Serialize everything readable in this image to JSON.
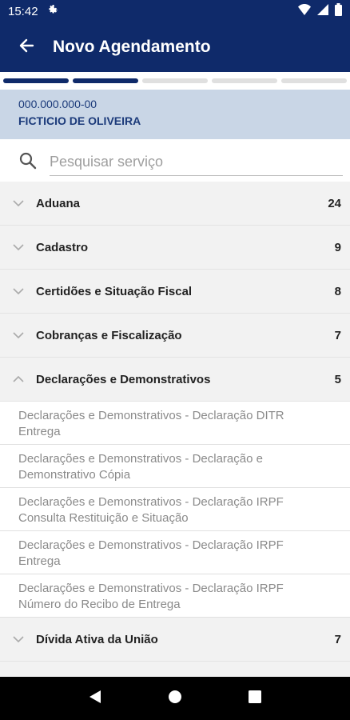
{
  "status_bar": {
    "time": "15:42"
  },
  "header": {
    "title": "Novo Agendamento"
  },
  "stepper": {
    "total_steps": 5,
    "completed_steps": 2
  },
  "profile": {
    "document": "000.000.000-00",
    "name": "FICTICIO DE OLIVEIRA"
  },
  "search": {
    "placeholder": "Pesquisar serviço",
    "value": ""
  },
  "categories": [
    {
      "label": "Aduana",
      "count": "24",
      "expanded": false
    },
    {
      "label": "Cadastro",
      "count": "9",
      "expanded": false
    },
    {
      "label": "Certidões e Situação Fiscal",
      "count": "8",
      "expanded": false
    },
    {
      "label": "Cobranças e Fiscalização",
      "count": "7",
      "expanded": false
    },
    {
      "label": "Declarações e Demonstrativos",
      "count": "5",
      "expanded": true
    }
  ],
  "sub_items": [
    {
      "line1": "Declarações e Demonstrativos - Declaração DITR",
      "line2": "Entrega"
    },
    {
      "line1": "Declarações e Demonstrativos - Declaração e",
      "line2": "Demonstrativo Cópia"
    },
    {
      "line1": "Declarações e Demonstrativos - Declaração IRPF",
      "line2": "Consulta Restituição e Situação"
    },
    {
      "line1": "Declarações e Demonstrativos - Declaração IRPF",
      "line2": "Entrega"
    },
    {
      "line1": "Declarações e Demonstrativos - Declaração IRPF",
      "line2": "Número do Recibo de Entrega"
    }
  ],
  "last_category": {
    "label": "Dívida Ativa da União",
    "count": "7",
    "expanded": false
  },
  "colors": {
    "primary": "#0f2a6a",
    "profile_bg": "#c9d6e6",
    "row_bg": "#f2f2f2"
  },
  "icons": {
    "status": [
      "settings-gear-icon",
      "wifi-icon",
      "signal-icon",
      "battery-icon"
    ],
    "nav": [
      "back-triangle-icon",
      "home-circle-icon",
      "recents-square-icon"
    ]
  }
}
